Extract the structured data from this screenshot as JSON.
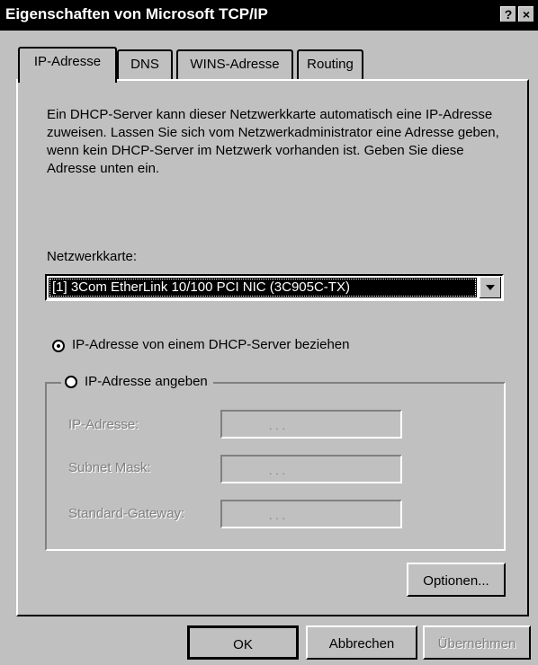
{
  "window": {
    "title": "Eigenschaften von Microsoft TCP/IP",
    "help_btn": "?",
    "close_btn": "×"
  },
  "tabs": [
    {
      "label": "IP-Adresse",
      "active": true
    },
    {
      "label": "DNS",
      "active": false
    },
    {
      "label": "WINS-Adresse",
      "active": false
    },
    {
      "label": "Routing",
      "active": false
    }
  ],
  "description": "Ein DHCP-Server kann dieser Netzwerkkarte automatisch eine IP-Adresse zuweisen. Lassen Sie sich vom Netzwerkadministrator eine Adresse geben, wenn kein DHCP-Server im Netzwerk vorhanden ist. Geben Sie diese Adresse unten ein.",
  "adapter": {
    "label": "Netzwerkkarte:",
    "selected": "[1] 3Com EtherLink 10/100 PCI NIC (3C905C-TX)"
  },
  "radios": {
    "dhcp": {
      "label": "IP-Adresse von einem DHCP-Server beziehen",
      "checked": true
    },
    "manual": {
      "label": "IP-Adresse angeben",
      "checked": false
    }
  },
  "fields": [
    {
      "label": "IP-Adresse:",
      "value": ". . ."
    },
    {
      "label": "Subnet Mask:",
      "value": ". . ."
    },
    {
      "label": "Standard-Gateway:",
      "value": ". . ."
    }
  ],
  "buttons": {
    "options": "Optionen...",
    "ok": "OK",
    "cancel": "Abbrechen",
    "apply": "Übernehmen"
  },
  "colors": {
    "face": "#c0c0c0",
    "titlebar": "#000000",
    "disabled_text": "#808080"
  }
}
